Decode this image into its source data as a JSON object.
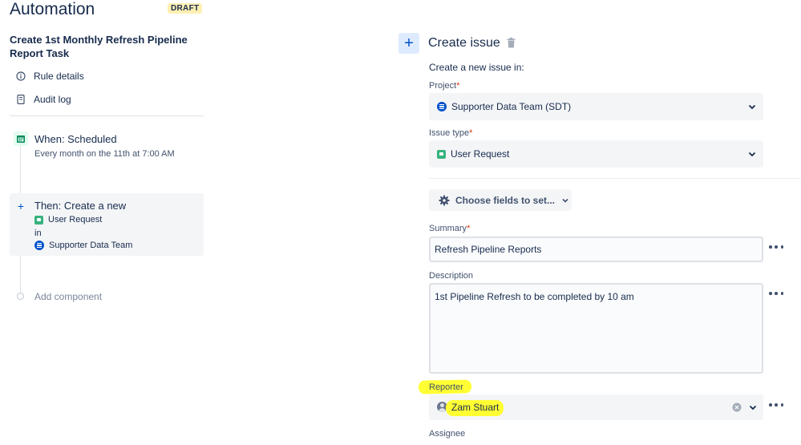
{
  "header": {
    "title": "Automation",
    "badge": "DRAFT"
  },
  "rule": {
    "name": "Create 1st Monthly Refresh Pipeline Report Task",
    "menu": [
      {
        "label": "Rule details",
        "icon": "info-icon"
      },
      {
        "label": "Audit log",
        "icon": "document-icon"
      }
    ]
  },
  "trigger": {
    "title": "When: Scheduled",
    "subtitle": "Every month on the 11th at 7:00 AM",
    "icon": "calendar-icon"
  },
  "action": {
    "title": "Then: Create a new",
    "issue_type": "User Request",
    "in_label": "in",
    "project": "Supporter Data Team"
  },
  "add_component": "Add component",
  "editor": {
    "title": "Create issue",
    "intro": "Create a new issue in:",
    "project_label": "Project",
    "project_value": "Supporter Data Team (SDT)",
    "issue_type_label": "Issue type",
    "issue_type_value": "User Request",
    "choose_fields": "Choose fields to set...",
    "summary_label": "Summary",
    "summary_value": "Refresh Pipeline Reports",
    "description_label": "Description",
    "description_value": "1st Pipeline Refresh to be completed by 10 am",
    "reporter_label": "Reporter",
    "reporter_value": "Zam Stuart",
    "assignee_label": "Assignee",
    "required_mark": "*"
  },
  "colors": {
    "accent": "#0052cc",
    "highlight": "#ffff33",
    "story_green": "#36b37e",
    "required_red": "#de350b"
  }
}
